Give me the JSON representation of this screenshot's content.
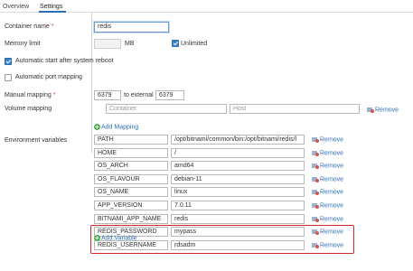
{
  "tabs": [
    {
      "label": "Overview",
      "active": false
    },
    {
      "label": "Settings",
      "active": true
    }
  ],
  "form": {
    "container_name": {
      "label": "Container name",
      "required_mark": "*",
      "value": "redis"
    },
    "memory_limit": {
      "label": "Memory limit",
      "value": "",
      "unit": "MB",
      "unlimited_label": "Unlimited",
      "unlimited_checked": true
    },
    "auto_start": {
      "label": "Automatic start after system reboot",
      "checked": true
    },
    "auto_port": {
      "label": "Automatic port mapping",
      "checked": false
    },
    "manual_mapping": {
      "label": "Manual mapping",
      "required_mark": "*",
      "port_from": "6379",
      "to_external_label": "to external",
      "port_to": "6379"
    },
    "volume_mapping": {
      "label": "Volume mapping",
      "container_placeholder": "Container",
      "host_placeholder": "Host",
      "remove_label": "Remove"
    },
    "add_mapping_label": "Add Mapping",
    "env": {
      "label": "Environment variables",
      "remove_label": "Remove",
      "rows": [
        {
          "name": "PATH",
          "value": "/opt/bitnami/common/bin:/opt/bitnami/redis/l"
        },
        {
          "name": "HOME",
          "value": "/"
        },
        {
          "name": "OS_ARCH",
          "value": "amd64"
        },
        {
          "name": "OS_FLAVOUR",
          "value": "debian-11"
        },
        {
          "name": "OS_NAME",
          "value": "linux"
        },
        {
          "name": "APP_VERSION",
          "value": "7.0.11"
        },
        {
          "name": "BITNAMI_APP_NAME",
          "value": "redis"
        },
        {
          "name": "REDIS_PASSWORD",
          "value": "mypass"
        },
        {
          "name": "REDIS_USERNAME",
          "value": "rdsadm"
        }
      ],
      "highlighted_rows": [
        "REDIS_PASSWORD",
        "REDIS_USERNAME"
      ]
    },
    "add_variable_label": "Add Variable"
  },
  "colors": {
    "accent": "#2f6fb8",
    "highlight": "#d02b2b",
    "checkbox": "#3b7fc4"
  },
  "icons": {
    "remove": "remove-icon",
    "add": "add-icon"
  }
}
